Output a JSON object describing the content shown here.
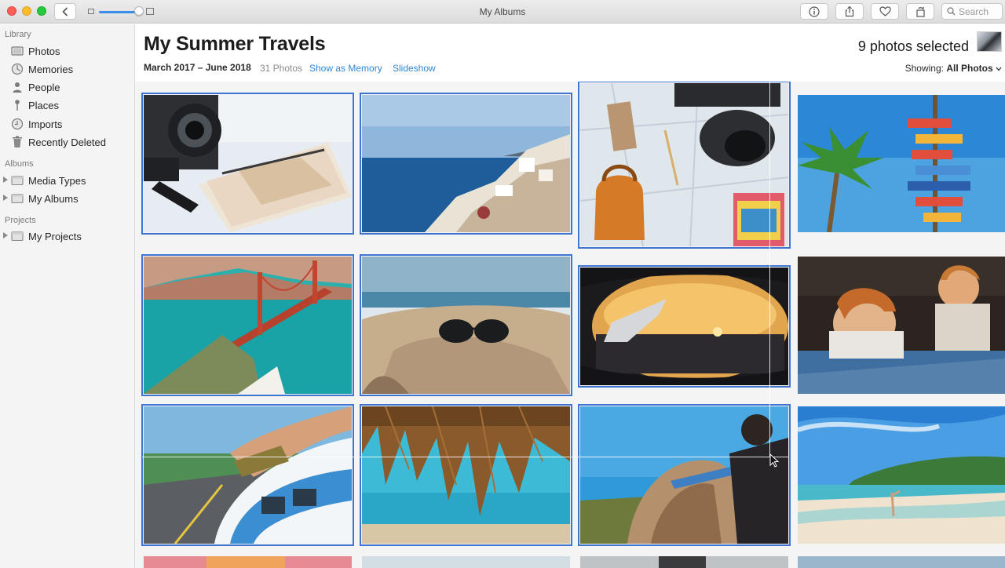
{
  "window": {
    "title": "My Albums",
    "search_placeholder": "Search"
  },
  "sidebar": {
    "library_heading": "Library",
    "library_items": [
      {
        "label": "Photos",
        "icon": "photos-icon"
      },
      {
        "label": "Memories",
        "icon": "memories-icon"
      },
      {
        "label": "People",
        "icon": "people-icon"
      },
      {
        "label": "Places",
        "icon": "places-icon"
      },
      {
        "label": "Imports",
        "icon": "imports-icon"
      },
      {
        "label": "Recently Deleted",
        "icon": "trash-icon"
      }
    ],
    "albums_heading": "Albums",
    "album_items": [
      {
        "label": "Media Types",
        "icon": "folder-icon"
      },
      {
        "label": "My Albums",
        "icon": "folder-icon"
      }
    ],
    "projects_heading": "Projects",
    "project_items": [
      {
        "label": "My Projects",
        "icon": "folder-icon"
      }
    ]
  },
  "header": {
    "title": "My Summer Travels",
    "date_range": "March 2017 – June 2018",
    "photo_count": "31 Photos",
    "show_as_memory": "Show as Memory",
    "slideshow": "Slideshow",
    "selected_text": "9 photos selected",
    "showing_label": "Showing:",
    "showing_value": "All Photos"
  },
  "zoom": {
    "level": 0.85
  },
  "photos": [
    {
      "subject": "camera and notebook",
      "selected": true
    },
    {
      "subject": "santorini coastline",
      "selected": true
    },
    {
      "subject": "flat lay map with backpack and camera",
      "selected": true
    },
    {
      "subject": "palm tree and signpost",
      "selected": false
    },
    {
      "subject": "golden gate bridge",
      "selected": true
    },
    {
      "subject": "sunglasses on sand",
      "selected": true
    },
    {
      "subject": "airplane window sunset",
      "selected": true
    },
    {
      "subject": "kids in a van",
      "selected": false
    },
    {
      "subject": "feet out of van window",
      "selected": true
    },
    {
      "subject": "straw umbrella over sea",
      "selected": true
    },
    {
      "subject": "man holding toy plane",
      "selected": true
    },
    {
      "subject": "tropical beach",
      "selected": false
    }
  ],
  "colors": {
    "accent": "#3f74d1",
    "link": "#2f87d8",
    "sidebar_bg": "#f4f4f4"
  }
}
